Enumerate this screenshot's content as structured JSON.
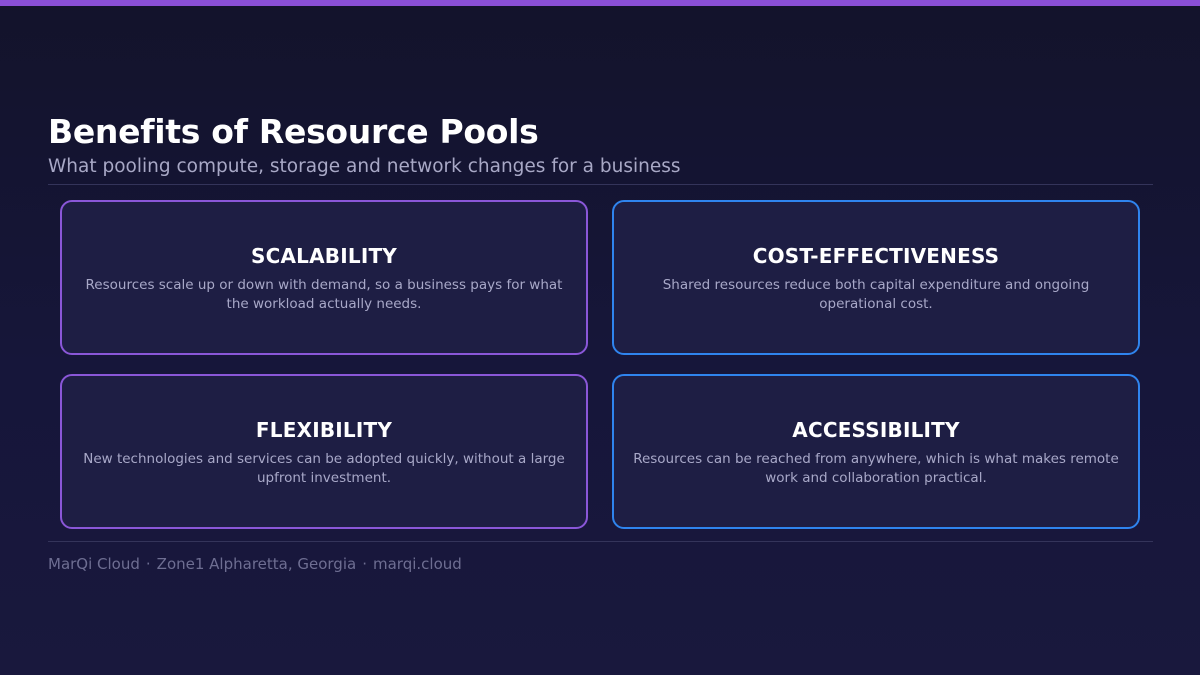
{
  "slide": {
    "title": "Benefits of Resource Pools",
    "subtitle": "What pooling compute, storage and network changes for a business"
  },
  "cards": [
    {
      "title": "SCALABILITY",
      "body": "Resources scale up or down with demand, so a business pays for what the workload actually needs.",
      "accent": "#8a57d8"
    },
    {
      "title": "COST-EFFECTIVENESS",
      "body": "Shared resources reduce both capital expenditure and ongoing operational cost.",
      "accent": "#2f84ee"
    },
    {
      "title": "FLEXIBILITY",
      "body": "New technologies and services can be adopted quickly, without a large upfront investment.",
      "accent": "#8a57d8"
    },
    {
      "title": "ACCESSIBILITY",
      "body": "Resources can be reached from anywhere, which is what makes remote work and collaboration practical.",
      "accent": "#2f84ee"
    }
  ],
  "footer": {
    "company": "MarQi Cloud",
    "location": "Zone1 Alpharetta, Georgia",
    "website": "marqi.cloud",
    "separator": "·"
  },
  "colors": {
    "background": "#14142e",
    "top_bar": "#8a4fd6",
    "purple_accent": "#8a57d8",
    "blue_accent": "#2f84ee"
  }
}
